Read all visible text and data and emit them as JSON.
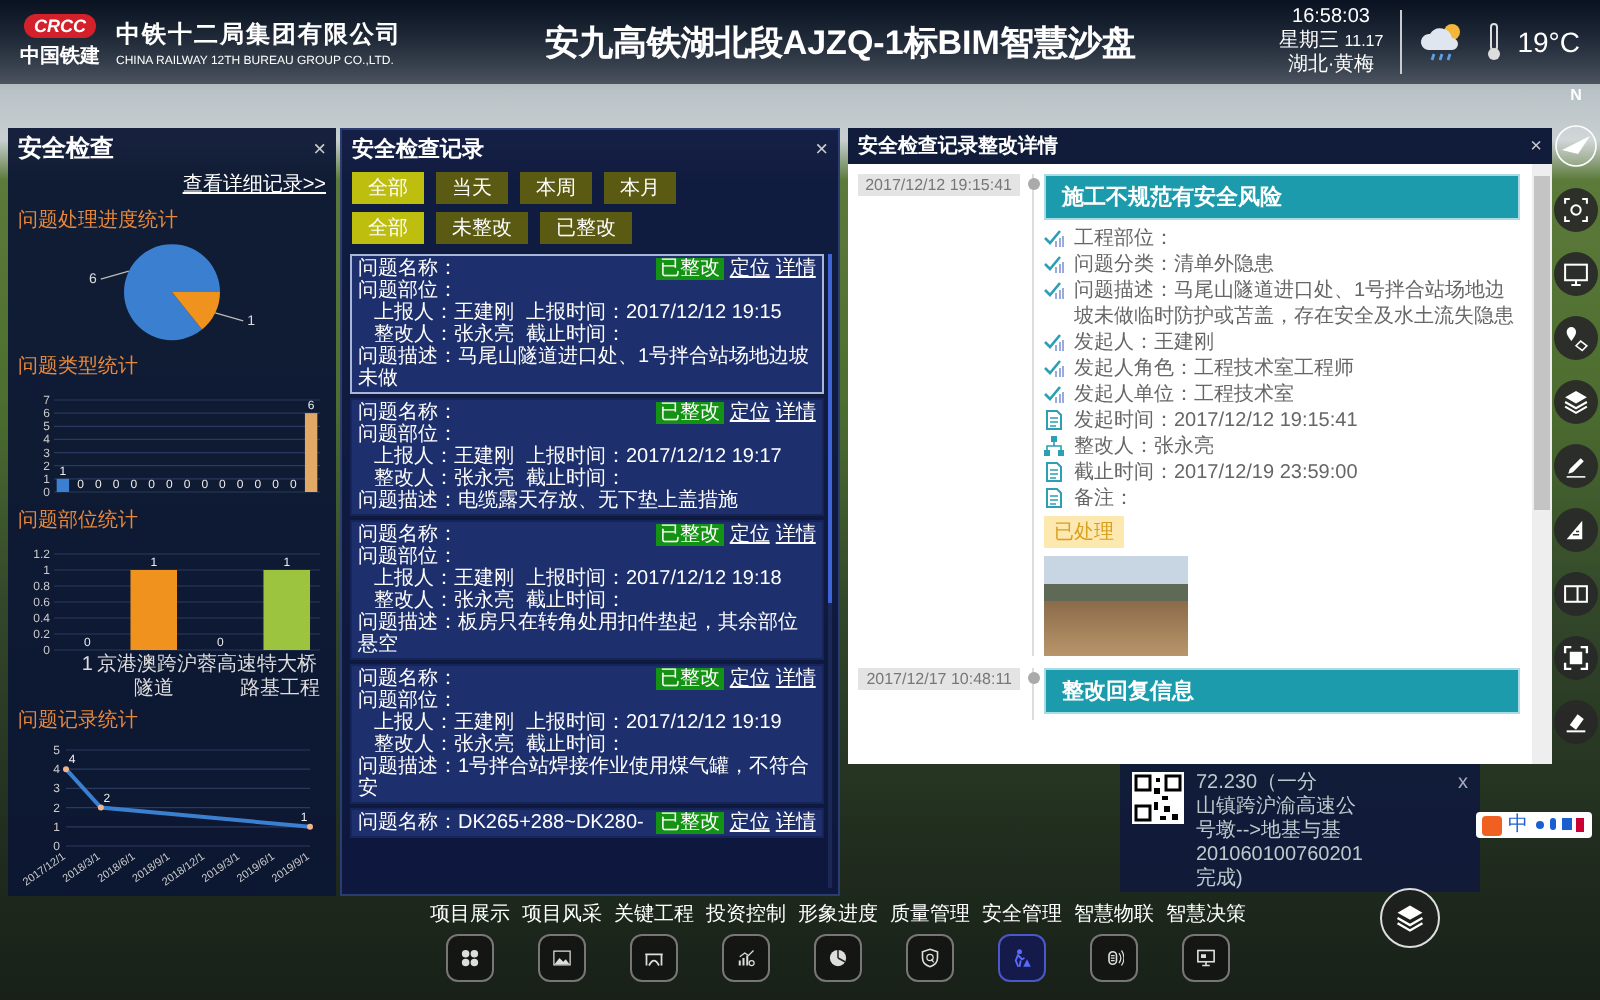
{
  "header": {
    "logo_text": "CRCC",
    "logo_caption": "中国铁建",
    "company": "中铁十二局集团有限公司",
    "company_en": "CHINA RAILWAY 12TH BUREAU GROUP CO.,LTD.",
    "title": "安九高铁湖北段AJZQ-1标BIM智慧沙盘",
    "time": "16:58:03",
    "weekday": "星期三",
    "date": "11.17",
    "location": "湖北·黄梅",
    "temperature": "19°C"
  },
  "compass": {
    "label": "N"
  },
  "safety_panel": {
    "title": "安全检查",
    "close": "×",
    "link": "查看详细记录>>",
    "sections": [
      {
        "title": "问题处理进度统计",
        "chart_data": {
          "type": "pie",
          "values": [
            6,
            1
          ],
          "data_labels": true
        }
      },
      {
        "title": "问题类型统计",
        "chart_data": {
          "type": "bar",
          "values": [
            1,
            0,
            0,
            0,
            0,
            0,
            0,
            0,
            0,
            0,
            0,
            0,
            0,
            0,
            6
          ],
          "ylim": [
            0,
            7
          ],
          "yticks": [
            0,
            1,
            2,
            3,
            4,
            5,
            6,
            7
          ],
          "grid": true,
          "data_labels": true
        }
      },
      {
        "title": "问题部位统计",
        "chart_data": {
          "type": "bar",
          "categories": [
            "1",
            "隧道",
            "京港澳跨沪蓉高速特大桥",
            "路基工程"
          ],
          "values": [
            0,
            1,
            0,
            1
          ],
          "ylim": [
            0,
            1.2
          ],
          "yticks": [
            0,
            0.2,
            0.4,
            0.6,
            0.8,
            1,
            1.2
          ],
          "grid": true,
          "data_labels": true
        }
      },
      {
        "title": "问题记录统计",
        "chart_data": {
          "type": "line",
          "categories": [
            "2017/12/1",
            "2018/3/1",
            "2018/6/1",
            "2018/9/1",
            "2018/12/1",
            "2019/3/1",
            "2019/6/1",
            "2019/9/1"
          ],
          "values": [
            4,
            2,
            null,
            null,
            null,
            null,
            null,
            1
          ],
          "marker": "circle",
          "ylim": [
            0,
            5
          ],
          "grid": true,
          "yticks": [
            0,
            1,
            2,
            3,
            4,
            5
          ],
          "data_labels": true
        }
      }
    ]
  },
  "records_panel": {
    "title": "安全检查记录",
    "close": "×",
    "date_filters": [
      {
        "label": "全部",
        "selected": true
      },
      {
        "label": "当天",
        "selected": false
      },
      {
        "label": "本周",
        "selected": false
      },
      {
        "label": "本月",
        "selected": false
      }
    ],
    "status_filters": [
      {
        "label": "全部",
        "selected": true
      },
      {
        "label": "未整改",
        "selected": false
      },
      {
        "label": "已整改",
        "selected": false
      }
    ],
    "records": [
      {
        "selected": true,
        "name": "问题名称：",
        "status": "已整改",
        "locate": "定位",
        "details": "详情",
        "location": "问题部位：",
        "reporter": "上报人：王建刚",
        "report_time": "上报时间：2017/12/12 19:15",
        "rectifier": "整改人：张永亮",
        "deadline": "截止时间：",
        "description": "问题描述：马尾山隧道进口处、1号拌合站场地边坡未做"
      },
      {
        "selected": false,
        "name": "问题名称：",
        "status": "已整改",
        "locate": "定位",
        "details": "详情",
        "location": "问题部位：",
        "reporter": "上报人：王建刚",
        "report_time": "上报时间：2017/12/12 19:17",
        "rectifier": "整改人：张永亮",
        "deadline": "截止时间：",
        "description": "问题描述：电缆露天存放、无下垫上盖措施"
      },
      {
        "selected": false,
        "name": "问题名称：",
        "status": "已整改",
        "locate": "定位",
        "details": "详情",
        "location": "问题部位：",
        "reporter": "上报人：王建刚",
        "report_time": "上报时间：2017/12/12 19:18",
        "rectifier": "整改人：张永亮",
        "deadline": "截止时间：",
        "description": "问题描述：板房只在转角处用扣件垫起，其余部位悬空"
      },
      {
        "selected": false,
        "name": "问题名称：",
        "status": "已整改",
        "locate": "定位",
        "details": "详情",
        "location": "问题部位：",
        "reporter": "上报人：王建刚",
        "report_time": "上报时间：2017/12/12 19:19",
        "rectifier": "整改人：张永亮",
        "deadline": "截止时间：",
        "description": "问题描述：1号拌合站焊接作业使用煤气罐，不符合安"
      },
      {
        "selected": false,
        "name": "问题名称：DK265+288~DK280-",
        "status": "已整改",
        "locate": "定位",
        "details": "详情"
      }
    ]
  },
  "detail_panel": {
    "title": "安全检查记录整改详情",
    "close": "×",
    "entries": [
      {
        "time": "2017/12/12 19:15:41",
        "heading": "施工不规范有安全风险",
        "items": [
          {
            "kind": "check",
            "text": "工程部位："
          },
          {
            "kind": "check",
            "text": "问题分类：清单外隐患"
          },
          {
            "kind": "check",
            "text": "问题描述：马尾山隧道进口处、1号拌合站场地边坡未做临时防护或苫盖，存在安全及水土流失隐患"
          },
          {
            "kind": "check",
            "text": "发起人：王建刚"
          },
          {
            "kind": "check",
            "text": "发起人角色：工程技术室工程师"
          },
          {
            "kind": "check",
            "text": "发起人单位：工程技术室"
          },
          {
            "kind": "doc",
            "text": "发起时间：2017/12/12 19:15:41"
          },
          {
            "kind": "org",
            "text": "整改人：张永亮"
          },
          {
            "kind": "doc",
            "text": "截止时间：2017/12/19 23:59:00"
          },
          {
            "kind": "doc",
            "text": "备注："
          }
        ],
        "badge": "已处理",
        "photo": true
      },
      {
        "time": "2017/12/17 10:48:11",
        "heading": "整改回复信息",
        "photo": false
      }
    ]
  },
  "background_panel": {
    "close": "x",
    "lines": [
      "72.230（一分",
      "山镇跨沪渝高速公",
      "号墩-->地基与基",
      "201060100760201",
      "完成)"
    ]
  },
  "input_method": {
    "label": "中"
  },
  "bottom_nav": [
    {
      "kind": "grid",
      "label": "项目展示",
      "selected": false
    },
    {
      "kind": "image",
      "label": "项目风采",
      "selected": false
    },
    {
      "kind": "bridge",
      "label": "关键工程",
      "selected": false
    },
    {
      "kind": "chart",
      "label": "投资控制",
      "selected": false
    },
    {
      "kind": "pie",
      "label": "形象进度",
      "selected": false
    },
    {
      "kind": "shield",
      "label": "质量管理",
      "selected": false
    },
    {
      "kind": "worker",
      "label": "安全管理",
      "selected": true
    },
    {
      "kind": "sensor",
      "label": "智慧物联",
      "selected": false
    },
    {
      "kind": "monitor",
      "label": "智慧决策",
      "selected": false
    }
  ]
}
